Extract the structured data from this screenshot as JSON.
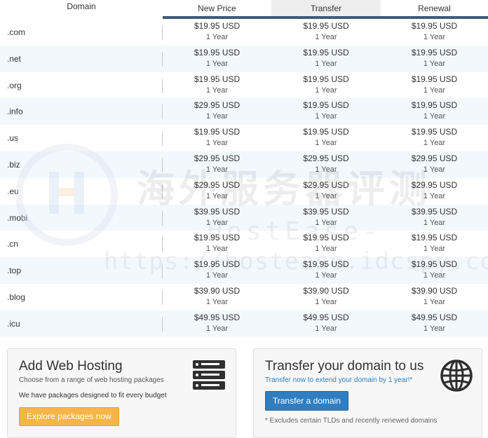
{
  "table": {
    "headers": {
      "domain": "Domain",
      "new_price": "New Price",
      "transfer": "Transfer",
      "renewal": "Renewal"
    },
    "rows": [
      {
        "tld": ".com",
        "new_price": "$19.95 USD",
        "transfer": "$19.95 USD",
        "renewal": "$19.95 USD",
        "term": "1 Year"
      },
      {
        "tld": ".net",
        "new_price": "$19.95 USD",
        "transfer": "$19.95 USD",
        "renewal": "$19.95 USD",
        "term": "1 Year"
      },
      {
        "tld": ".org",
        "new_price": "$19.95 USD",
        "transfer": "$19.95 USD",
        "renewal": "$19.95 USD",
        "term": "1 Year"
      },
      {
        "tld": ".info",
        "new_price": "$29.95 USD",
        "transfer": "$19.95 USD",
        "renewal": "$19.95 USD",
        "term": "1 Year"
      },
      {
        "tld": ".us",
        "new_price": "$19.95 USD",
        "transfer": "$19.95 USD",
        "renewal": "$19.95 USD",
        "term": "1 Year"
      },
      {
        "tld": ".biz",
        "new_price": "$29.95 USD",
        "transfer": "$29.95 USD",
        "renewal": "$29.95 USD",
        "term": "1 Year"
      },
      {
        "tld": ".eu",
        "new_price": "$29.95 USD",
        "transfer": "$29.95 USD",
        "renewal": "$29.95 USD",
        "term": "1 Year"
      },
      {
        "tld": ".mobi",
        "new_price": "$39.95 USD",
        "transfer": "$39.95 USD",
        "renewal": "$39.95 USD",
        "term": "1 Year"
      },
      {
        "tld": ".cn",
        "new_price": "$19.95 USD",
        "transfer": "$19.95 USD",
        "renewal": "$19.95 USD",
        "term": "1 Year"
      },
      {
        "tld": ".top",
        "new_price": "$19.95 USD",
        "transfer": "$19.95 USD",
        "renewal": "$19.95 USD",
        "term": "1 Year"
      },
      {
        "tld": ".blog",
        "new_price": "$39.90 USD",
        "transfer": "$39.90 USD",
        "renewal": "$39.90 USD",
        "term": "1 Year"
      },
      {
        "tld": ".icu",
        "new_price": "$49.95 USD",
        "transfer": "$49.95 USD",
        "renewal": "$49.95 USD",
        "term": "1 Year"
      }
    ]
  },
  "hosting_card": {
    "title": "Add Web Hosting",
    "subtitle": "Choose from a range of web hosting packages",
    "body": "We have packages designed to fit every budget",
    "button_label": "Explore packages now",
    "icon": "server-icon"
  },
  "transfer_card": {
    "title": "Transfer your domain to us",
    "subtitle": "Transfer now to extend your domain by 1 year!*",
    "button_label": "Transfer a domain",
    "note": "* Excludes certain TLDs and recently renewed domains",
    "icon": "globe-icon"
  },
  "watermark": {
    "cn_text": "海外服务器评测",
    "brand_text": "-HostEase-",
    "url_text": "https://hostease.idcspy.com/"
  },
  "colors": {
    "header_underline": "#3f5a7a",
    "row_alt": "#f3f8fd",
    "orange_button": "#f6b547",
    "blue_button": "#2f7ec1",
    "link_blue": "#2c7fc0"
  }
}
